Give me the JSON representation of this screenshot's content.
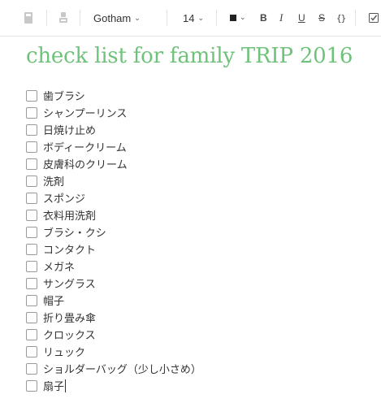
{
  "toolbar": {
    "font_name": "Gotham",
    "font_size": "14",
    "bold": "B",
    "italic": "I",
    "underline": "U",
    "strikethrough": "S",
    "code": "{}",
    "icons": [
      "note-icon",
      "stamp-icon",
      "color-swatch-icon",
      "checkbox-icon"
    ],
    "text_color": "#222222"
  },
  "note": {
    "title": "check list for family TRIP 2016",
    "title_color": "#6fc27a",
    "items": [
      "歯ブラシ",
      "シャンプーリンス",
      "日焼け止め",
      "ボディークリーム",
      "皮膚科のクリーム",
      "洗剤",
      "スポンジ",
      "衣料用洗剤",
      "ブラシ・クシ",
      "コンタクト",
      "メガネ",
      "サングラス",
      "帽子",
      "折り畳み傘",
      "クロックス",
      "リュック",
      "ショルダーバッグ（少し小さめ）",
      "扇子"
    ]
  }
}
